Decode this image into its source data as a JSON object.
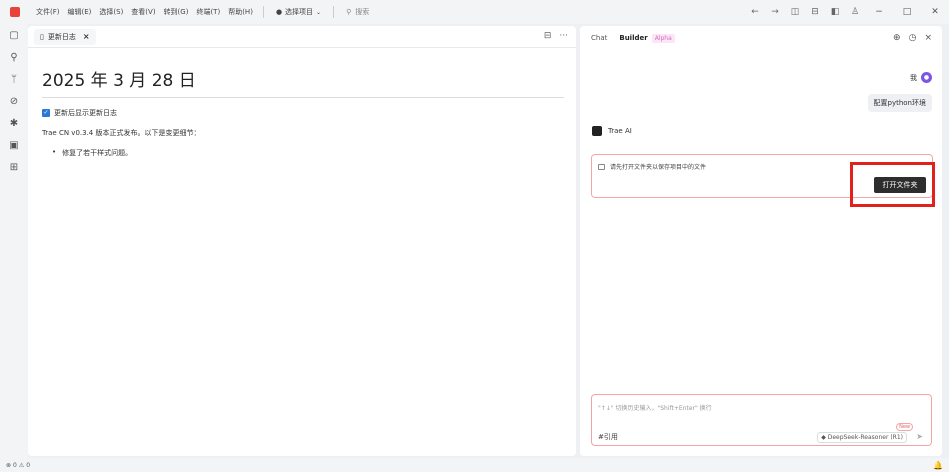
{
  "menu": [
    "文件(F)",
    "编辑(E)",
    "选择(S)",
    "查看(V)",
    "转到(G)",
    "终端(T)",
    "帮助(H)"
  ],
  "project_select": "选择项目",
  "search_label": "搜索",
  "tab": {
    "label": "更新日志"
  },
  "doc": {
    "title": "2025 年 3 月 28 日",
    "checkbox_label": "更新后显示更新日志",
    "release_text": "Trae CN v0.3.4 版本正式发布。以下是变更细节：",
    "bullets": [
      "修复了若干样式问题。"
    ]
  },
  "chat": {
    "tab_chat": "Chat",
    "tab_builder": "Builder",
    "builder_badge": "Alpha",
    "user_name": "我",
    "user_message": "配置python环境",
    "ai_name": "Trae AI",
    "ai_message": "请先打开文件夹以保存项目中的文件",
    "open_folder_label": "打开文件夹",
    "input_placeholder": "\"↑↓\" 切换历史输入，\"Shift+Enter\" 换行",
    "ref_label": "#引用",
    "model_label": "DeepSeek-Reasoner (R1)",
    "new_badge": "New"
  },
  "status": {
    "errors": "0",
    "warnings": "0"
  },
  "colors": {
    "accent_red": "#e0211c",
    "avatar_purple": "#7d55e6"
  }
}
